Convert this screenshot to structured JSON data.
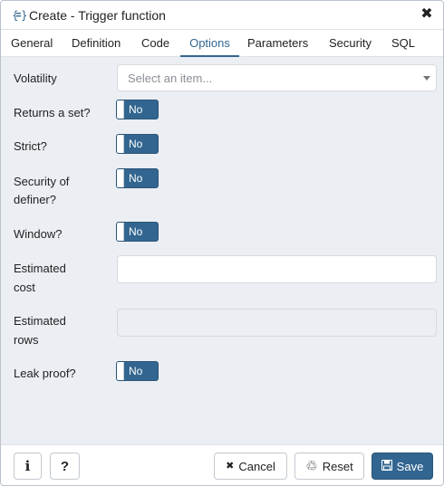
{
  "dialog": {
    "title": "Create - Trigger function",
    "close_symbol": "✖"
  },
  "tabs": [
    {
      "label": "General",
      "active": false
    },
    {
      "label": "Definition",
      "active": false
    },
    {
      "label": "Code",
      "active": false
    },
    {
      "label": "Options",
      "active": true
    },
    {
      "label": "Parameters",
      "active": false
    },
    {
      "label": "Security",
      "active": false
    },
    {
      "label": "SQL",
      "active": false
    }
  ],
  "form": {
    "volatility": {
      "label": "Volatility",
      "placeholder": "Select an item..."
    },
    "returns_set": {
      "label": "Returns a set?",
      "value": "No"
    },
    "strict": {
      "label": "Strict?",
      "value": "No"
    },
    "security_definer": {
      "label_line1": "Security of",
      "label_line2": "definer?",
      "value": "No"
    },
    "window": {
      "label": "Window?",
      "value": "No"
    },
    "estimated_cost": {
      "label_line1": "Estimated",
      "label_line2": "cost",
      "value": ""
    },
    "estimated_rows": {
      "label_line1": "Estimated",
      "label_line2": "rows",
      "value": ""
    },
    "leak_proof": {
      "label": "Leak proof?",
      "value": "No"
    }
  },
  "footer": {
    "info_symbol": "i",
    "help_symbol": "?",
    "cancel_label": "Cancel",
    "reset_label": "Reset",
    "save_label": "Save",
    "cancel_icon": "✖",
    "reset_icon": "♲",
    "save_icon": "💾"
  },
  "colors": {
    "accent": "#326690",
    "panel": "#ebeef3"
  },
  "icons": {
    "title": "function-braces-icon"
  }
}
